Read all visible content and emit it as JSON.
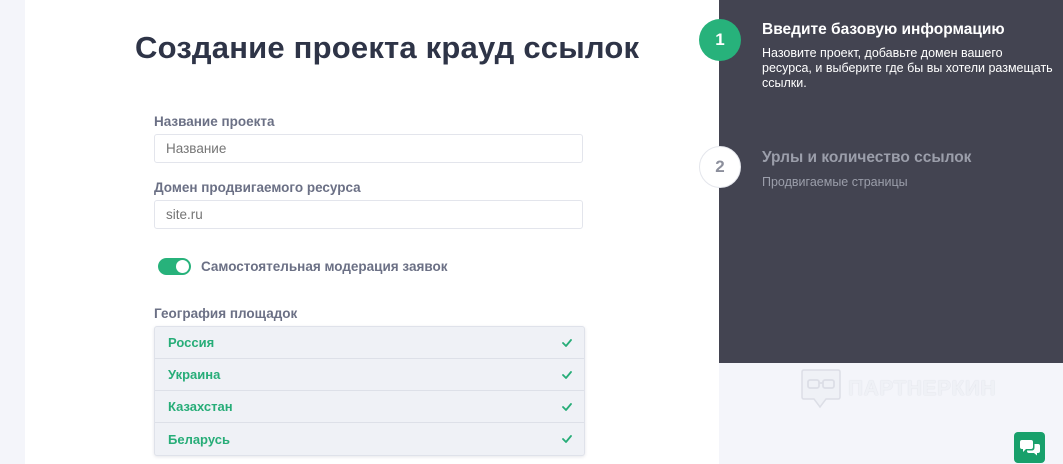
{
  "form": {
    "title": "Создание проекта крауд ссылок",
    "project_name": {
      "label": "Название проекта",
      "placeholder": "Название",
      "value": ""
    },
    "domain": {
      "label": "Домен продвигаемого ресурса",
      "placeholder": "site.ru",
      "value": ""
    },
    "moderation_toggle": {
      "label": "Самостоятельная модерация заявок",
      "checked": true
    },
    "geography": {
      "label": "География площадок",
      "options": [
        {
          "name": "Россия",
          "selected": true
        },
        {
          "name": "Украина",
          "selected": true
        },
        {
          "name": "Казахстан",
          "selected": true
        },
        {
          "name": "Беларусь",
          "selected": true
        }
      ]
    }
  },
  "steps": [
    {
      "number": "1",
      "title": "Введите базовую информацию",
      "description": "Назовите проект, добавьте домен вашего ресурса, и выберите где бы вы хотели размещать ссылки.",
      "active": true
    },
    {
      "number": "2",
      "title": "Урлы и количество ссылок",
      "description": "Продвигаемые страницы",
      "active": false
    }
  ],
  "watermark": {
    "text": "ПАРТНЕРКИН",
    "icon": "glasses-speech-bubble-logo"
  },
  "chat_button": {
    "icon": "chat-bubbles-icon"
  },
  "colors": {
    "accent": "#27b27b",
    "sidebar": "#434451",
    "title": "#2e3447",
    "label": "#6b7085",
    "background": "#f4f5fa"
  }
}
